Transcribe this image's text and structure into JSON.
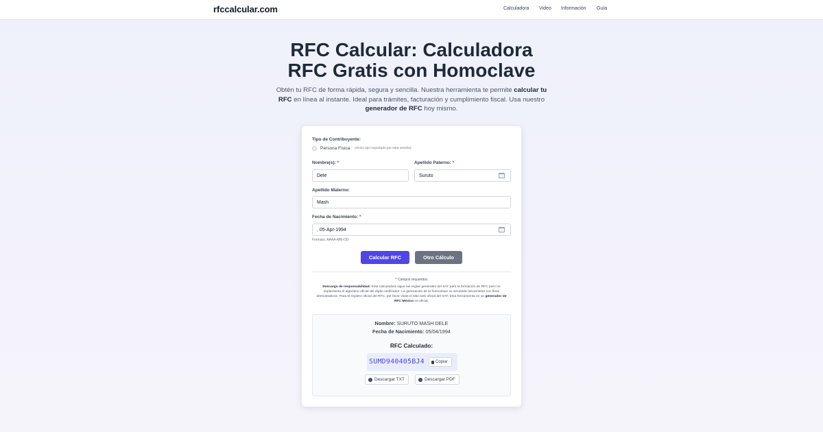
{
  "header": {
    "brand": "rfccalcular.com",
    "nav": [
      "Calculadora",
      "Video",
      "Información",
      "Guía"
    ]
  },
  "hero": {
    "title_line1": "RFC Calcular: Calculadora",
    "title_line2": "RFC Gratis con Homoclave",
    "sub_1": "Obtén tu RFC de forma rápida, segura y sencilla. Nuestra herramienta te permite",
    "sub_bold1": "calcular tu RFC",
    "sub_2": "en línea al instante. Ideal para trámites, facturación y cumplimiento fiscal. Usa nuestro",
    "sub_bold2": "generador de RFC",
    "sub_3": "hoy mismo."
  },
  "form": {
    "tipo_label": "Tipo de Contribuyente:",
    "tipo_option": "Persona Física",
    "tipo_note": "(Único tipo soportado por esta versión)",
    "nombre_label": "Nombre(s):",
    "nombre_value": "Dele",
    "paterno_label": "Apellido Paterno:",
    "paterno_value": "Suruto",
    "materno_label": "Apellido Materno:",
    "materno_value": "Mash",
    "fecha_label": "Fecha de Nacimiento:",
    "fecha_value": ", 05-Apr-1994",
    "fecha_hint": "Formato: AAAA-MM-DD",
    "required_mark": "*",
    "calc_button": "Calcular RFC",
    "reset_button": "Otro Cálculo"
  },
  "notes": {
    "required": "* Campos requeridos",
    "disclaimer_bold": "Descargo de responsabilidad:",
    "disclaimer_text": "Esta calculadora sigue las reglas generales del SAT para la formación de RFC pero no implementa el algoritmo oficial del dígito verificador. La generación de la homoclave es simulada únicamente con fines demostrativos. Para el registro oficial del RFC, por favor visite el sitio web oficial del SAT. Esta herramienta es un",
    "disclaimer_bold2": "generador de RFC México",
    "disclaimer_end": "no oficial."
  },
  "result": {
    "nombre_label": "Nombre:",
    "nombre_value": "SURUTO MASH DELE",
    "fecha_label": "Fecha de Nacimiento:",
    "fecha_value": "05/04/1994",
    "rfc_title": "RFC Calculado:",
    "rfc_code": "SUMD940405BJ4",
    "copy_button": "Copiar",
    "txt_button": "Descargar TXT",
    "pdf_button": "Descargar PDF"
  },
  "colors": {
    "accent": "#4f46e5",
    "secondary_button": "#6b7280",
    "required": "#dc2626"
  },
  "icons": [
    "calendar-icon",
    "copy-icon",
    "download-icon"
  ]
}
